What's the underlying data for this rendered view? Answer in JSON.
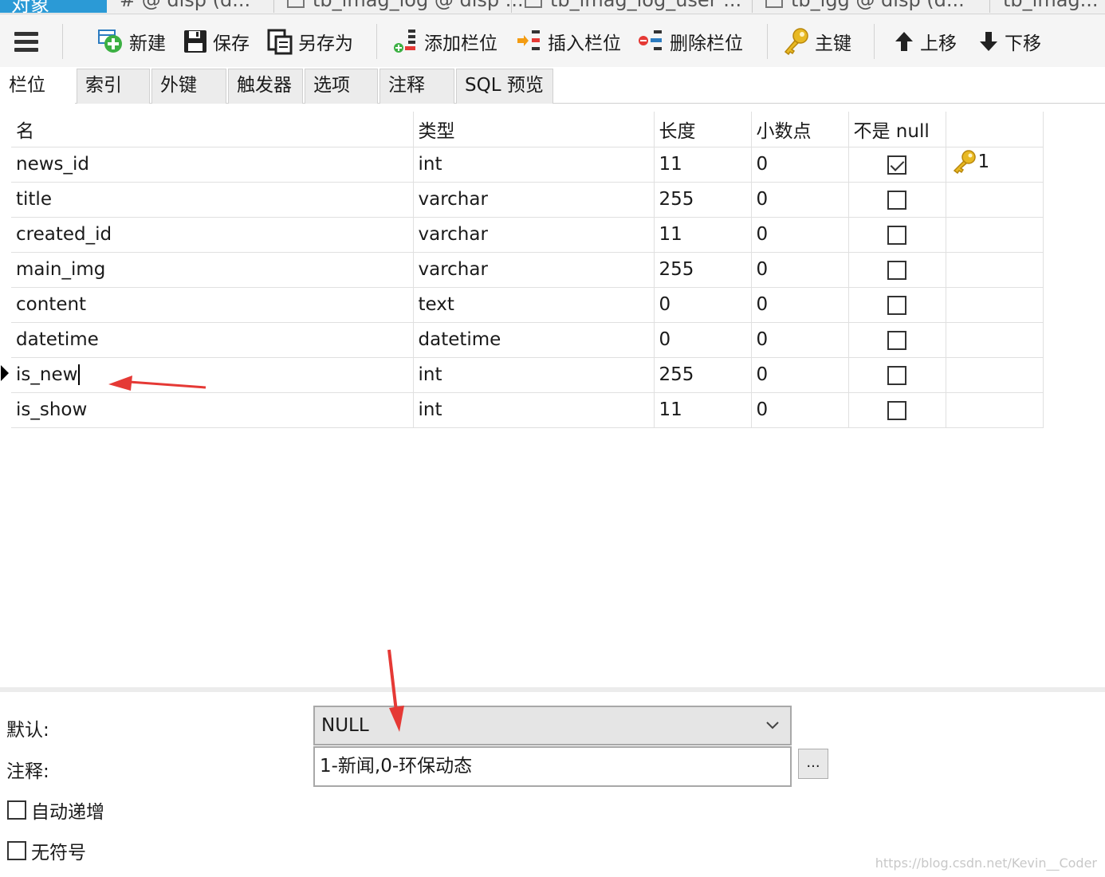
{
  "doc_tabs": [
    {
      "label": "对象",
      "active": true
    },
    {
      "label": "# @ disp (d...",
      "active": false
    },
    {
      "label": "tb_imag_log @ disp ...",
      "active": false
    },
    {
      "label": "tb_imag_log_user ...",
      "active": false
    },
    {
      "label": "tb_lgg @ disp (d...",
      "active": false
    },
    {
      "label": "tb_imag...",
      "active": false
    }
  ],
  "toolbar": {
    "new": "新建",
    "save": "保存",
    "save_as": "另存为",
    "add_field": "添加栏位",
    "insert_field": "插入栏位",
    "delete_field": "删除栏位",
    "primary_key": "主键",
    "move_up": "上移",
    "move_down": "下移"
  },
  "subtabs": [
    "栏位",
    "索引",
    "外键",
    "触发器",
    "选项",
    "注释",
    "SQL 预览"
  ],
  "grid": {
    "columns": [
      "名",
      "类型",
      "长度",
      "小数点",
      "不是 null",
      ""
    ],
    "rows": [
      {
        "name": "news_id",
        "type": "int",
        "length": "11",
        "decimals": "0",
        "not_null": true,
        "key": "1"
      },
      {
        "name": "title",
        "type": "varchar",
        "length": "255",
        "decimals": "0",
        "not_null": false,
        "key": ""
      },
      {
        "name": "created_id",
        "type": "varchar",
        "length": "11",
        "decimals": "0",
        "not_null": false,
        "key": ""
      },
      {
        "name": "main_img",
        "type": "varchar",
        "length": "255",
        "decimals": "0",
        "not_null": false,
        "key": ""
      },
      {
        "name": "content",
        "type": "text",
        "length": "0",
        "decimals": "0",
        "not_null": false,
        "key": ""
      },
      {
        "name": "datetime",
        "type": "datetime",
        "length": "0",
        "decimals": "0",
        "not_null": false,
        "key": ""
      },
      {
        "name": "is_new",
        "type": "int",
        "length": "255",
        "decimals": "0",
        "not_null": false,
        "key": ""
      },
      {
        "name": "is_show",
        "type": "int",
        "length": "11",
        "decimals": "0",
        "not_null": false,
        "key": ""
      }
    ]
  },
  "props": {
    "default_label": "默认:",
    "default_value": "NULL",
    "comment_label": "注释:",
    "comment_value": "1-新闻,0-环保动态",
    "ellipsis": "...",
    "auto_increment_label": "自动递增",
    "unsigned_label": "无符号",
    "auto_increment": false,
    "unsigned": false
  },
  "watermark": "https://blog.csdn.net/Kevin__Coder",
  "colors": {
    "accent": "#2b9ad6",
    "annotation_arrow": "#e53935",
    "key": "#e8b923"
  }
}
